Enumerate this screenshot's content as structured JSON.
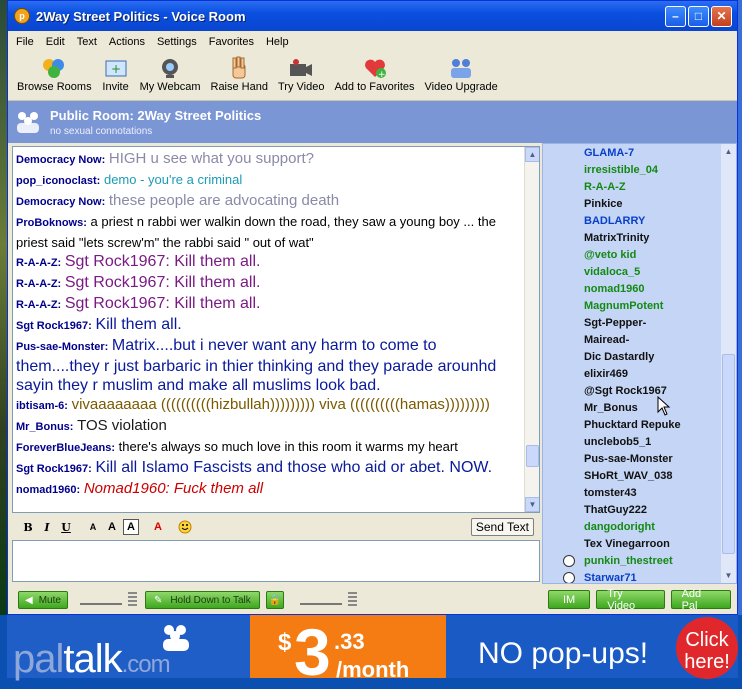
{
  "window": {
    "title": "2Way Street Politics - Voice Room"
  },
  "menu": [
    "File",
    "Edit",
    "Text",
    "Actions",
    "Settings",
    "Favorites",
    "Help"
  ],
  "toolbar": [
    {
      "label": "Browse Rooms",
      "icon": "browse-rooms-icon"
    },
    {
      "label": "Invite",
      "icon": "invite-icon"
    },
    {
      "label": "My Webcam",
      "icon": "webcam-icon"
    },
    {
      "label": "Raise Hand",
      "icon": "hand-icon"
    },
    {
      "label": "Try Video",
      "icon": "video-camera-icon"
    },
    {
      "label": "Add to Favorites",
      "icon": "add-favorite-icon"
    },
    {
      "label": "Video Upgrade",
      "icon": "video-upgrade-icon"
    }
  ],
  "room": {
    "title": "Public Room: 2Way Street Politics",
    "subtitle": "no sexual connotations"
  },
  "chat": [
    {
      "nick": "Democracy Now:",
      "text": "HIGH u see what you support?",
      "color": "#8a8aa8",
      "size": 15
    },
    {
      "nick": "pop_iconoclast:",
      "text": "demo - you're a criminal",
      "color": "#1c9bb7",
      "size": 13
    },
    {
      "nick": "Democracy Now:",
      "text": "these people are advocating death",
      "color": "#8a8aa8",
      "size": 15
    },
    {
      "nick": "ProBoknows:",
      "text": "a priest n rabbi wer walkin down the road, they saw a young boy ... the priest said \"lets screw'm\" the rabbi said \" out of wat\"",
      "color": "#000000",
      "size": 13
    },
    {
      "nick": "R-A-A-Z:",
      "text": "Sgt Rock1967: Kill them all.",
      "color": "#7a1a84",
      "size": 16
    },
    {
      "nick": "R-A-A-Z:",
      "text": "Sgt Rock1967: Kill them all.",
      "color": "#7a1a84",
      "size": 16
    },
    {
      "nick": "R-A-A-Z:",
      "text": "Sgt Rock1967: Kill them all.",
      "color": "#7a1a84",
      "size": 16
    },
    {
      "nick": "Sgt Rock1967:",
      "text": "Kill them all.",
      "color": "#0a1a9a",
      "size": 16
    },
    {
      "nick": "Pus-sae-Monster:",
      "text": "Matrix....but i never want any harm to come to them....they r just barbaric in thier thinking and they parade arounhd sayin they r muslim and make all muslims look bad.",
      "color": "#0a1a9a",
      "size": 16
    },
    {
      "nick": "ibtisam-6:",
      "text": "vivaaaaaaaa ((((((((((hizbullah))))))))) viva ((((((((((hamas)))))))))",
      "color": "#7a5a00",
      "size": 15
    },
    {
      "nick": "Mr_Bonus:",
      "text": "TOS violation",
      "color": "#1a1a1a",
      "size": 15
    },
    {
      "nick": "ForeverBlueJeans:",
      "text": "there's always so much love in this room   it warms my heart",
      "color": "#000000",
      "size": 13
    },
    {
      "nick": "Sgt Rock1967:",
      "text": "Kill all Islamo Fascists and those who aid or abet. NOW.",
      "color": "#0a1a9a",
      "size": 16
    },
    {
      "nick": "nomad1960:",
      "text": "Nomad1960: Fuck them all",
      "color": "#cc0000",
      "size": 15
    }
  ],
  "format": {
    "send_label": "Send Text"
  },
  "voice": {
    "mute_label": "Mute",
    "talk_label": "Hold Down to Talk"
  },
  "users": [
    {
      "name": "GLAMA-7",
      "color": "#0a40c8",
      "clock": false
    },
    {
      "name": "irresistible_04",
      "color": "#138a13",
      "clock": false
    },
    {
      "name": "R-A-A-Z",
      "color": "#138a13",
      "clock": false
    },
    {
      "name": "Pinkice",
      "color": "#111111",
      "clock": false
    },
    {
      "name": "BADLARRY",
      "color": "#0a40c8",
      "clock": false
    },
    {
      "name": "MatrixTrinity",
      "color": "#111111",
      "clock": false
    },
    {
      "name": "@veto kid",
      "color": "#138a13",
      "clock": false
    },
    {
      "name": "vidaloca_5",
      "color": "#138a13",
      "clock": false
    },
    {
      "name": "nomad1960",
      "color": "#138a13",
      "clock": false
    },
    {
      "name": "MagnumPotent",
      "color": "#138a13",
      "clock": false
    },
    {
      "name": "Sgt-Pepper-",
      "color": "#111111",
      "clock": false
    },
    {
      "name": "Mairead-",
      "color": "#111111",
      "clock": false
    },
    {
      "name": "Dic Dastardly",
      "color": "#111111",
      "clock": false
    },
    {
      "name": "elixir469",
      "color": "#111111",
      "clock": false
    },
    {
      "name": "@Sgt Rock1967",
      "color": "#111111",
      "clock": false
    },
    {
      "name": "Mr_Bonus",
      "color": "#111111",
      "clock": false
    },
    {
      "name": "Phucktard Repuke",
      "color": "#111111",
      "clock": false
    },
    {
      "name": "unclebob5_1",
      "color": "#111111",
      "clock": false
    },
    {
      "name": "Pus-sae-Monster",
      "color": "#111111",
      "clock": false
    },
    {
      "name": "SHoRt_WAV_038",
      "color": "#111111",
      "clock": false
    },
    {
      "name": "tomster43",
      "color": "#111111",
      "clock": false
    },
    {
      "name": "ThatGuy222",
      "color": "#111111",
      "clock": false
    },
    {
      "name": "dangodoright",
      "color": "#138a13",
      "clock": false
    },
    {
      "name": "Tex Vinegarroon",
      "color": "#111111",
      "clock": false
    },
    {
      "name": "punkin_thestreet",
      "color": "#138a13",
      "clock": true
    },
    {
      "name": "Starwar71",
      "color": "#0a40c8",
      "clock": true
    }
  ],
  "user_buttons": [
    "IM",
    "Try Video",
    "Add Pal"
  ],
  "banner": {
    "logo_pal": "pal",
    "logo_talk": "talk",
    "logo_com": ".com",
    "price_dollar": "$",
    "price_int": "3",
    "price_dec": ".33",
    "price_per": "/month",
    "nopopups": "NO pop-ups!",
    "click": "Click here!"
  }
}
